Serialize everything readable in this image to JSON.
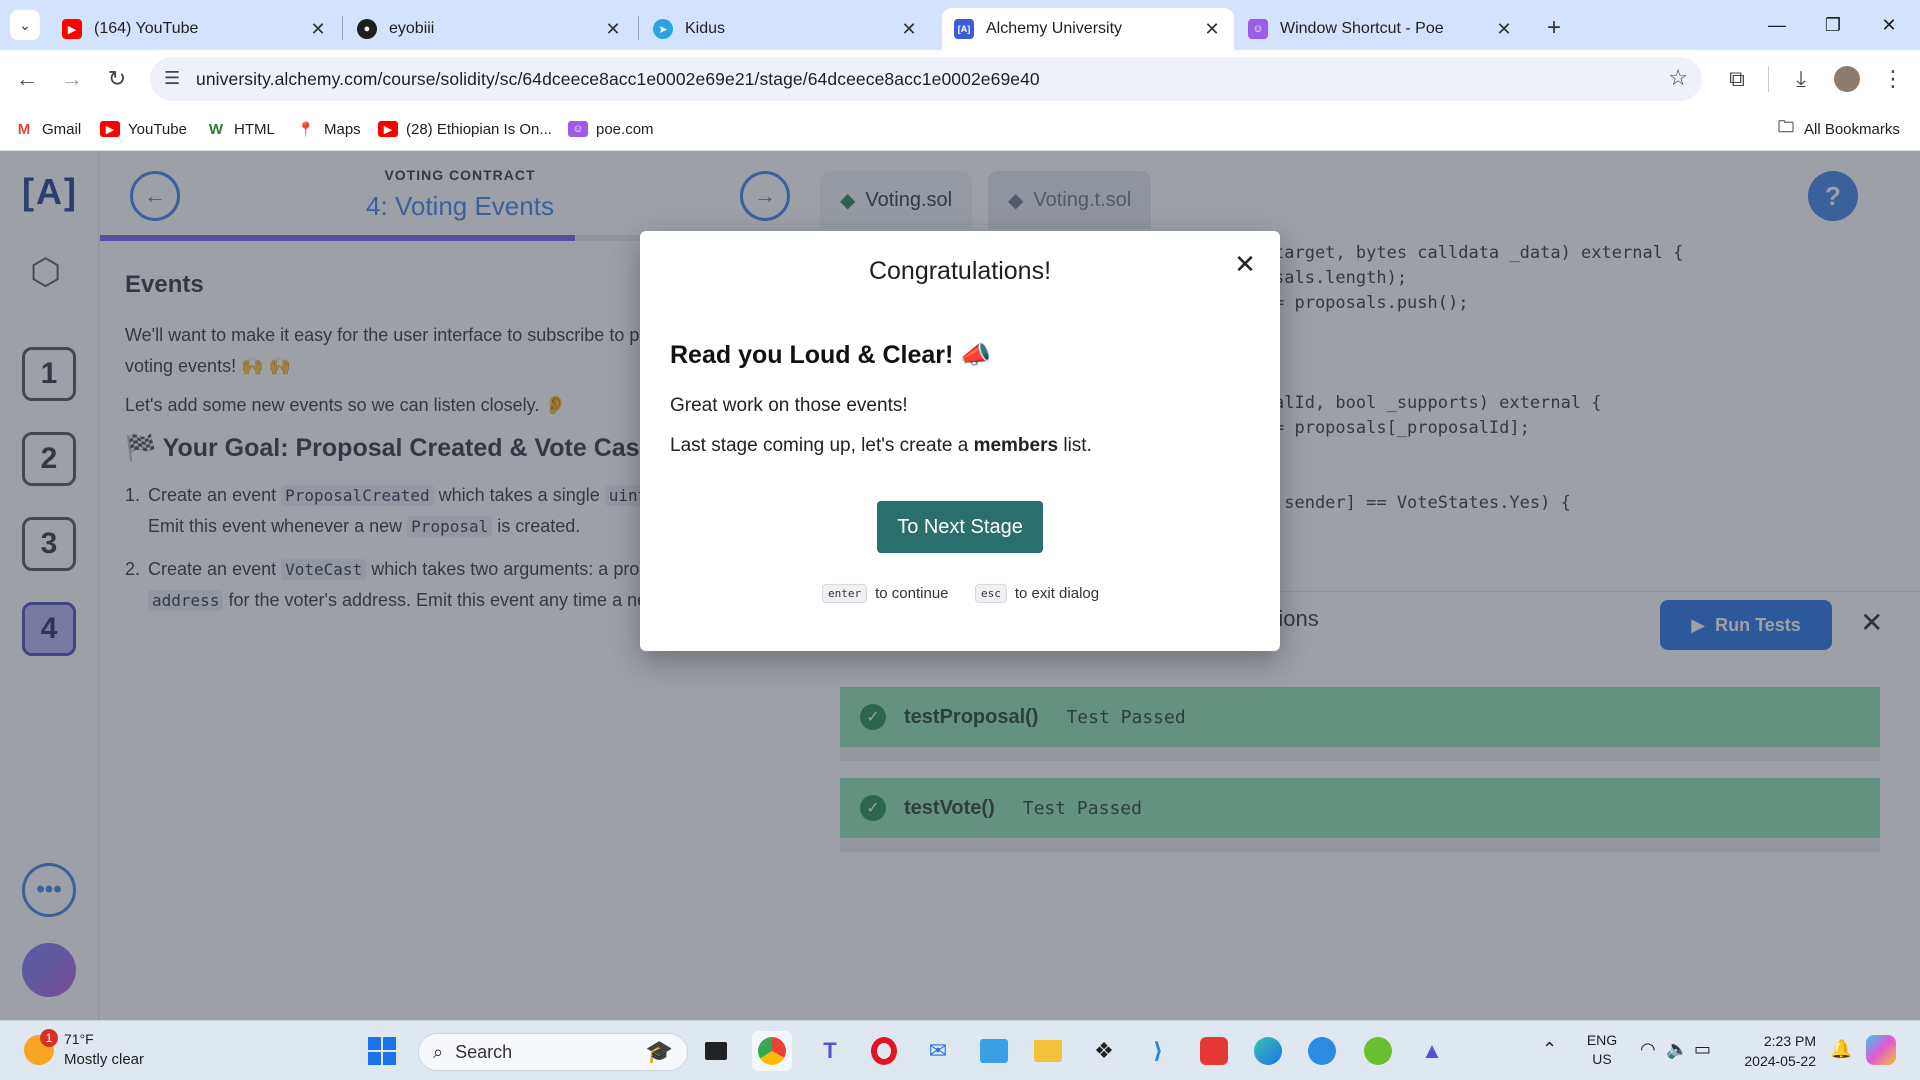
{
  "tabs": [
    {
      "title": "(164) YouTube",
      "icon": "youtube-icon",
      "color": "#ff0000"
    },
    {
      "title": "eyobiii",
      "icon": "github-icon",
      "color": "#1f1f1f"
    },
    {
      "title": "Kidus",
      "icon": "telegram-icon",
      "color": "#2aa3e0"
    },
    {
      "title": "Alchemy University",
      "icon": "alchemy-icon",
      "color": "#3b5bdb",
      "glyph": "[A]"
    },
    {
      "title": "Window Shortcut - Poe",
      "icon": "poe-icon",
      "color": "#9b5de5"
    }
  ],
  "toolbar": {
    "url": "university.alchemy.com/course/solidity/sc/64dceece8acc1e0002e69e21/stage/64dceece8acc1e0002e69e40"
  },
  "bookmarks": {
    "items": [
      {
        "label": "Gmail",
        "icon": "gmail-icon",
        "glyph": "M",
        "color": "#ea4335"
      },
      {
        "label": "YouTube",
        "icon": "youtube-icon",
        "glyph": "▶",
        "color": "#ff0000"
      },
      {
        "label": "HTML",
        "icon": "w3-icon",
        "glyph": "W",
        "color": "#2e7d32"
      },
      {
        "label": "Maps",
        "icon": "maps-icon",
        "glyph": "📍",
        "color": "transparent"
      },
      {
        "label": "(28) Ethiopian Is On...",
        "icon": "youtube-icon",
        "glyph": "▶",
        "color": "#ff0000"
      },
      {
        "label": "poe.com",
        "icon": "poe-icon",
        "glyph": "☺",
        "color": "#9b5de5"
      }
    ],
    "all_label": "All Bookmarks"
  },
  "lesson": {
    "logo": "[A]",
    "eyebrow": "VOTING CONTRACT",
    "title": "4: Voting Events",
    "section": "Events",
    "intro": "We'll want to make it easy for the user interface to subscribe to proposal and voting events! 🙌 🙌",
    "listen": "Let's add some new events so we can listen closely. 👂",
    "goal": "🏁 Your Goal: Proposal Created & Vote Cast",
    "step1_a": "Create an event",
    "step1_code": "ProposalCreated",
    "step1_b": "which takes a single",
    "step1_code2": "uint",
    "step1_c": "proposal ID. Emit this event whenever a new",
    "step1_code3": "Proposal",
    "step1_d": "is created.",
    "step2_a": "Create an event",
    "step2_code": "VoteCast",
    "step2_b": "which takes two arguments: a",
    "step2_c": "proposal ID and an",
    "step2_code2": "address",
    "step2_d": "for the voter's address. Emit this event any time a new vote is cast."
  },
  "stages": [
    "1",
    "2",
    "3",
    "4"
  ],
  "active_stage": "4",
  "editor": {
    "tabs": [
      "Voting.sol",
      "Voting.t.sol"
    ],
    "help": "?",
    "code_lines": [
      "target, bytes calldata _data) external {",
      "sals.length);",
      "= proposals.push();",
      "",
      "",
      "",
      "",
      "alId, bool _supports) external {",
      "= proposals[_proposalId];",
      "",
      "",
      ".sender] == VoteStates.Yes) {"
    ]
  },
  "results": {
    "tab_partial": "ations",
    "run_label": "Run Tests",
    "tests": [
      {
        "name": "testProposal()",
        "status": "Test Passed"
      },
      {
        "name": "testVote()",
        "status": "Test Passed"
      }
    ]
  },
  "modal": {
    "title": "Congratulations!",
    "heading": "Read you Loud & Clear! 📣",
    "p1": "Great work on those events!",
    "p2_a": "Last stage coming up, let's create a",
    "p2_bold": "members",
    "p2_b": "list.",
    "button": "To Next Stage",
    "hint_enter_key": "enter",
    "hint_enter": "to continue",
    "hint_esc_key": "esc",
    "hint_esc": "to exit dialog"
  },
  "taskbar": {
    "weather_temp": "71°F",
    "weather_desc": "Mostly clear",
    "weather_badge": "1",
    "search": "Search",
    "lang": "ENG",
    "region": "US",
    "time": "2:23 PM",
    "date": "2024-05-22"
  }
}
